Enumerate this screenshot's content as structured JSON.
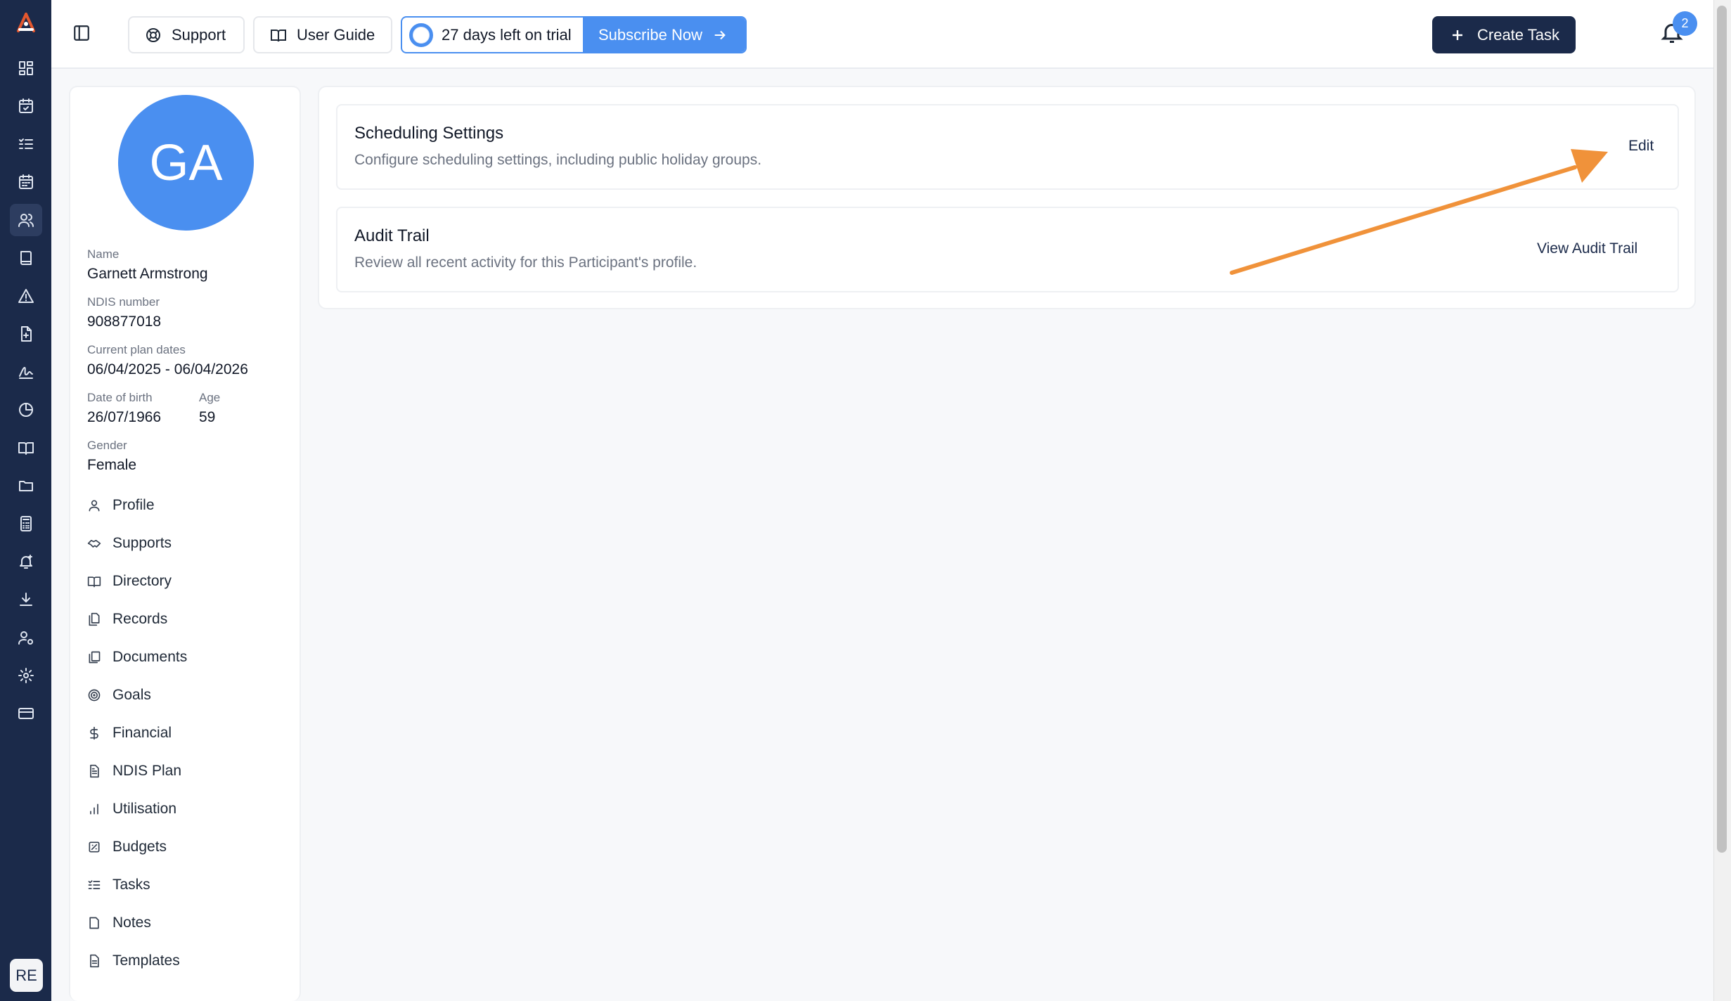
{
  "rail": {
    "icons": [
      "dashboard-icon",
      "calendar-check-icon",
      "list-check-icon",
      "calendar-icon",
      "users-icon",
      "book-icon",
      "alert-icon",
      "file-plus-icon",
      "signature-icon",
      "pie-chart-icon",
      "open-book-icon",
      "folder-icon",
      "calculator-icon",
      "bell-plus-icon",
      "download-icon",
      "user-settings-icon",
      "gear-icon",
      "credit-card-icon"
    ],
    "active": "users-icon",
    "user_initials": "RE",
    "brand_color": "#e4572e"
  },
  "topbar": {
    "support_label": "Support",
    "user_guide_label": "User Guide",
    "trial_text": "27 days left on trial",
    "subscribe_label": "Subscribe Now",
    "create_task_label": "Create Task",
    "notification_count": "2"
  },
  "profile": {
    "initials": "GA",
    "name_label": "Name",
    "name": "Garnett Armstrong",
    "ndis_label": "NDIS number",
    "ndis": "908877018",
    "plan_dates_label": "Current plan dates",
    "plan_dates": "06/04/2025 - 06/04/2026",
    "dob_label": "Date of birth",
    "dob": "26/07/1966",
    "age_label": "Age",
    "age": "59",
    "gender_label": "Gender",
    "gender": "Female"
  },
  "nav": {
    "items": [
      {
        "label": "Profile",
        "icon": "user-icon"
      },
      {
        "label": "Supports",
        "icon": "handshake-icon"
      },
      {
        "label": "Directory",
        "icon": "book-open-icon"
      },
      {
        "label": "Records",
        "icon": "files-icon"
      },
      {
        "label": "Documents",
        "icon": "documents-icon"
      },
      {
        "label": "Goals",
        "icon": "target-icon"
      },
      {
        "label": "Financial",
        "icon": "dollar-icon"
      },
      {
        "label": "NDIS Plan",
        "icon": "file-text-icon"
      },
      {
        "label": "Utilisation",
        "icon": "bar-chart-icon"
      },
      {
        "label": "Budgets",
        "icon": "budget-icon"
      },
      {
        "label": "Tasks",
        "icon": "list-check-icon"
      },
      {
        "label": "Notes",
        "icon": "note-icon"
      },
      {
        "label": "Templates",
        "icon": "template-icon"
      }
    ]
  },
  "settings": {
    "scheduling": {
      "title": "Scheduling Settings",
      "description": "Configure scheduling settings, including public holiday groups.",
      "action": "Edit"
    },
    "audit": {
      "title": "Audit Trail",
      "description": "Review all recent activity for this Participant's profile.",
      "action": "View Audit Trail"
    }
  },
  "colors": {
    "accent": "#4a8ff0",
    "navy": "#1b2a4a",
    "annotation_arrow": "#f0923a"
  }
}
